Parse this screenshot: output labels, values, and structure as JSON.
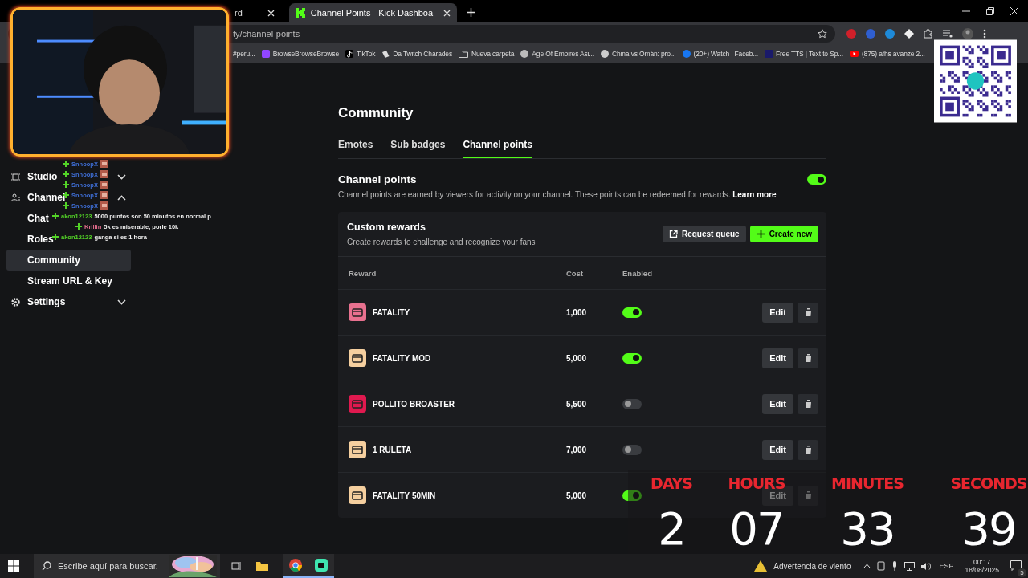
{
  "browser": {
    "tabs": [
      {
        "title": "rd",
        "selected": false
      },
      {
        "title": "Channel Points - Kick Dashboa",
        "selected": true
      }
    ],
    "address": "ty/channel-points",
    "bookmarks": [
      {
        "label": "#peru...",
        "kind": "none"
      },
      {
        "label": "BrowseBrowseBrowse",
        "kind": "twitch"
      },
      {
        "label": "TikTok",
        "kind": "tiktok"
      },
      {
        "label": "Da Twitch Charades",
        "kind": "cards"
      },
      {
        "label": "Nueva carpeta",
        "kind": "folder"
      },
      {
        "label": "Age Of Empires Asi...",
        "kind": "globe"
      },
      {
        "label": "China vs Omán: pro...",
        "kind": "badge"
      },
      {
        "label": "(20+) Watch | Faceb...",
        "kind": "facebook"
      },
      {
        "label": "Free TTS | Text to Sp...",
        "kind": "square"
      },
      {
        "label": "(875) afhs avanze 2...",
        "kind": "youtube"
      }
    ]
  },
  "sidebar": {
    "items": [
      {
        "label": "Studio",
        "kind": "studio",
        "expanded": false
      },
      {
        "label": "Channel",
        "kind": "channel",
        "expanded": true,
        "children": [
          {
            "label": "Chat",
            "selected": false
          },
          {
            "label": "Roles",
            "selected": false
          },
          {
            "label": "Community",
            "selected": true
          },
          {
            "label": "Stream URL & Key",
            "selected": false
          }
        ]
      },
      {
        "label": "Settings",
        "kind": "settings",
        "expanded": false
      }
    ]
  },
  "chat_overlay": [
    {
      "user": "SnnoopX",
      "color": "#3f6fd8"
    },
    {
      "user": "SnnoopX",
      "color": "#3f6fd8"
    },
    {
      "user": "SnnoopX",
      "color": "#3f6fd8"
    },
    {
      "user": "SnnoopX",
      "color": "#3f6fd8"
    },
    {
      "user": "SnnoopX",
      "color": "#3f6fd8"
    },
    {
      "user": "akon12123",
      "color": "#53d327",
      "text": "5000 puntos son 50 minutos en normal p"
    },
    {
      "user": "Krillin",
      "color": "#e06b8b",
      "text": "5k es miserable, porle 10k"
    },
    {
      "user": "akon12123",
      "color": "#53d327",
      "text": "ganga si es 1 hora"
    }
  ],
  "page": {
    "title": "Community",
    "tabs": [
      {
        "label": "Emotes",
        "selected": false
      },
      {
        "label": "Sub badges",
        "selected": false
      },
      {
        "label": "Channel points",
        "selected": true
      }
    ],
    "channel_points": {
      "title": "Channel points",
      "on": true,
      "description": "Channel points are earned by viewers for activity on your channel. These points can be redeemed for rewards.",
      "link": "Learn more"
    },
    "custom_rewards": {
      "title": "Custom rewards",
      "subtitle": "Create rewards to challenge and recognize your fans",
      "request_queue": "Request queue",
      "create_new": "Create new",
      "columns": [
        "Reward",
        "Cost",
        "Enabled"
      ],
      "rows": [
        {
          "name": "FATALITY",
          "cost": "1,000",
          "enabled": true,
          "color": "#e8718f",
          "edit": "Edit"
        },
        {
          "name": "FATALITY MOD",
          "cost": "5,000",
          "enabled": true,
          "color": "#f5cf9f",
          "edit": "Edit"
        },
        {
          "name": "POLLITO BROASTER",
          "cost": "5,500",
          "enabled": false,
          "color": "#e0194f",
          "edit": "Edit"
        },
        {
          "name": "1 RULETA",
          "cost": "7,000",
          "enabled": false,
          "color": "#f5cf9f",
          "edit": "Edit"
        },
        {
          "name": "FATALITY 50MIN",
          "cost": "5,000",
          "enabled": true,
          "color": "#f5cf9f",
          "edit": "Edit"
        }
      ]
    }
  },
  "countdown": [
    {
      "label": "DAYS",
      "value": "2"
    },
    {
      "label": "HOURS",
      "value": "07"
    },
    {
      "label": "MINUTES",
      "value": "33"
    },
    {
      "label": "SECONDS",
      "value": "39"
    }
  ],
  "taskbar": {
    "search_placeholder": "Escribe aquí para buscar.",
    "weather": "Advertencia de viento",
    "language": "ESP",
    "time": "00:17",
    "date": "18/08/2025",
    "notifications": "5"
  }
}
